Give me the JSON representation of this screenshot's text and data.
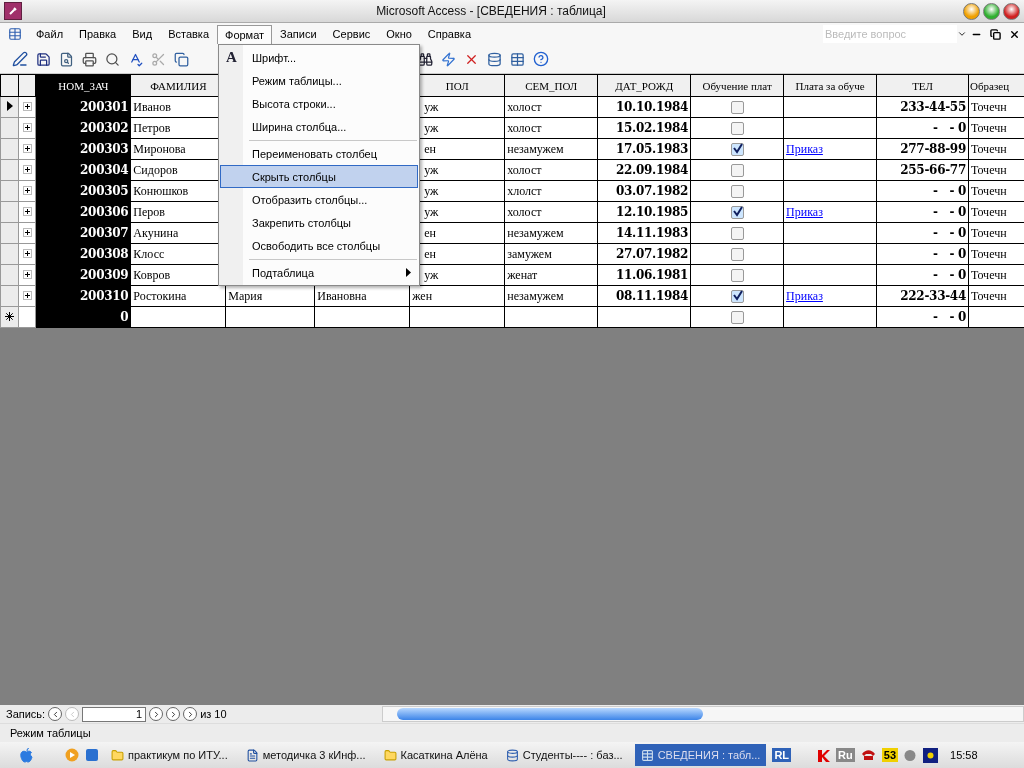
{
  "window": {
    "title": "Microsoft Access - [СВЕДЕНИЯ : таблица]"
  },
  "menu_bar": [
    {
      "label": "Файл",
      "selected": false
    },
    {
      "label": "Правка",
      "selected": false
    },
    {
      "label": "Вид",
      "selected": false
    },
    {
      "label": "Вставка",
      "selected": false
    },
    {
      "label": "Формат",
      "selected": true
    },
    {
      "label": "Записи",
      "selected": false
    },
    {
      "label": "Сервис",
      "selected": false
    },
    {
      "label": "Окно",
      "selected": false
    },
    {
      "label": "Справка",
      "selected": false
    }
  ],
  "help_box": {
    "placeholder": "Введите вопрос"
  },
  "format_menu": [
    {
      "label": "Шрифт...",
      "glyph": "A",
      "selected": false,
      "separator_before": false
    },
    {
      "label": "Режим таблицы...",
      "selected": false,
      "separator_before": false
    },
    {
      "label": "Высота строки...",
      "selected": false,
      "separator_before": false
    },
    {
      "label": "Ширина столбца...",
      "selected": false,
      "separator_before": false
    },
    {
      "label": "Переименовать столбец",
      "selected": false,
      "separator_before": true
    },
    {
      "label": "Скрыть столбцы",
      "selected": true,
      "separator_before": false
    },
    {
      "label": "Отобразить столбцы...",
      "selected": false,
      "separator_before": false
    },
    {
      "label": "Закрепить столбцы",
      "selected": false,
      "separator_before": false
    },
    {
      "label": "Освободить все столбцы",
      "selected": false,
      "separator_before": false
    },
    {
      "label": "Подтаблица",
      "selected": false,
      "separator_before": true,
      "submenu": true
    }
  ],
  "table": {
    "columns": [
      {
        "label": "НОМ_ЗАЧ",
        "frozen": true
      },
      {
        "label": "ФАМИЛИЯ",
        "frozen": false
      },
      {},
      {},
      {
        "label": "ПОЛ",
        "frozen": false
      },
      {
        "label": "СЕМ_ПОЛ",
        "frozen": false
      },
      {
        "label": "ДАТ_РОЖД",
        "frozen": false
      },
      {
        "label": "Обучение плат",
        "frozen": false
      },
      {
        "label": "Плата за обуче",
        "frozen": false
      },
      {
        "label": "ТЕЛ",
        "frozen": false
      },
      {
        "label": "Образец",
        "frozen": false
      }
    ],
    "rows": [
      {
        "current": true,
        "kind": "record",
        "num": "200301",
        "surname": "Иванов",
        "sex": "уж",
        "status": "холост",
        "birth": "10.10.1984",
        "paid": false,
        "tel": "233-44-55",
        "sample": "Точечн"
      },
      {
        "current": false,
        "kind": "record",
        "num": "200302",
        "surname": "Петров",
        "sex": "уж",
        "status": "холост",
        "birth": "15.02.1984",
        "paid": false,
        "tel": "-   - 0",
        "sample": "Точечн"
      },
      {
        "current": false,
        "kind": "record",
        "num": "200303",
        "surname": "Миронова",
        "sex": "ен",
        "status": "незамужем",
        "birth": "17.05.1983",
        "paid": true,
        "payment": "Приказ",
        "tel": "277-88-99",
        "sample": "Точечн"
      },
      {
        "current": false,
        "kind": "record",
        "num": "200304",
        "surname": "Сидоров",
        "sex": "уж",
        "status": "холост",
        "birth": "22.09.1984",
        "paid": false,
        "tel": "255-66-77",
        "sample": "Точечн"
      },
      {
        "current": false,
        "kind": "record",
        "num": "200305",
        "surname": "Конюшков",
        "sex": "уж",
        "status": "хлолст",
        "birth": "03.07.1982",
        "paid": false,
        "tel": "-   - 0",
        "sample": "Точечн"
      },
      {
        "current": false,
        "kind": "record",
        "num": "200306",
        "surname": "Перов",
        "sex": "уж",
        "status": "холост",
        "birth": "12.10.1985",
        "paid": true,
        "payment": "Приказ",
        "tel": "-   - 0",
        "sample": "Точечн"
      },
      {
        "current": false,
        "kind": "record",
        "num": "200307",
        "surname": "Акунина",
        "sex": "ен",
        "status": "незамужем",
        "birth": "14.11.1983",
        "paid": false,
        "tel": "-   - 0",
        "sample": "Точечн"
      },
      {
        "current": false,
        "kind": "record",
        "num": "200308",
        "surname": "Клосс",
        "sex": "ен",
        "status": "замужем",
        "birth": "27.07.1982",
        "paid": false,
        "tel": "-   - 0",
        "sample": "Точечн"
      },
      {
        "current": false,
        "kind": "record",
        "num": "200309",
        "surname": "Ковров",
        "sex": "уж",
        "status": "женат",
        "birth": "11.06.1981",
        "paid": false,
        "tel": "-   - 0",
        "sample": "Точечн"
      },
      {
        "current": false,
        "kind": "record",
        "num": "200310",
        "surname": "Ростокина",
        "name": "Мария",
        "patronymic": "Ивановна",
        "sex": "жен",
        "status": "незамужем",
        "birth": "08.11.1984",
        "paid": true,
        "payment": "Приказ",
        "tel": "222-33-44",
        "sample": "Точечн"
      },
      {
        "current": false,
        "kind": "new",
        "num": "0",
        "paid": false,
        "tel": "-   - 0"
      }
    ]
  },
  "record_nav": {
    "label": "Запись:",
    "current": "1",
    "of": "из",
    "total": "10"
  },
  "status_bar": "Режим таблицы",
  "taskbar": {
    "items": [
      {
        "label": "практикум по ИТУ...",
        "kind": "folder",
        "selected": false
      },
      {
        "label": "методичка 3 кИнф...",
        "kind": "word",
        "selected": false
      },
      {
        "label": "Касаткина Алёна",
        "kind": "folder",
        "selected": false
      },
      {
        "label": "Студенты---- : баз...",
        "kind": "database",
        "selected": false
      },
      {
        "label": "СВЕДЕНИЯ : табл...",
        "kind": "table",
        "selected": true
      }
    ],
    "language": "RL",
    "tray_lang": "Ru",
    "tray_badge": "53",
    "clock": "15:58"
  }
}
